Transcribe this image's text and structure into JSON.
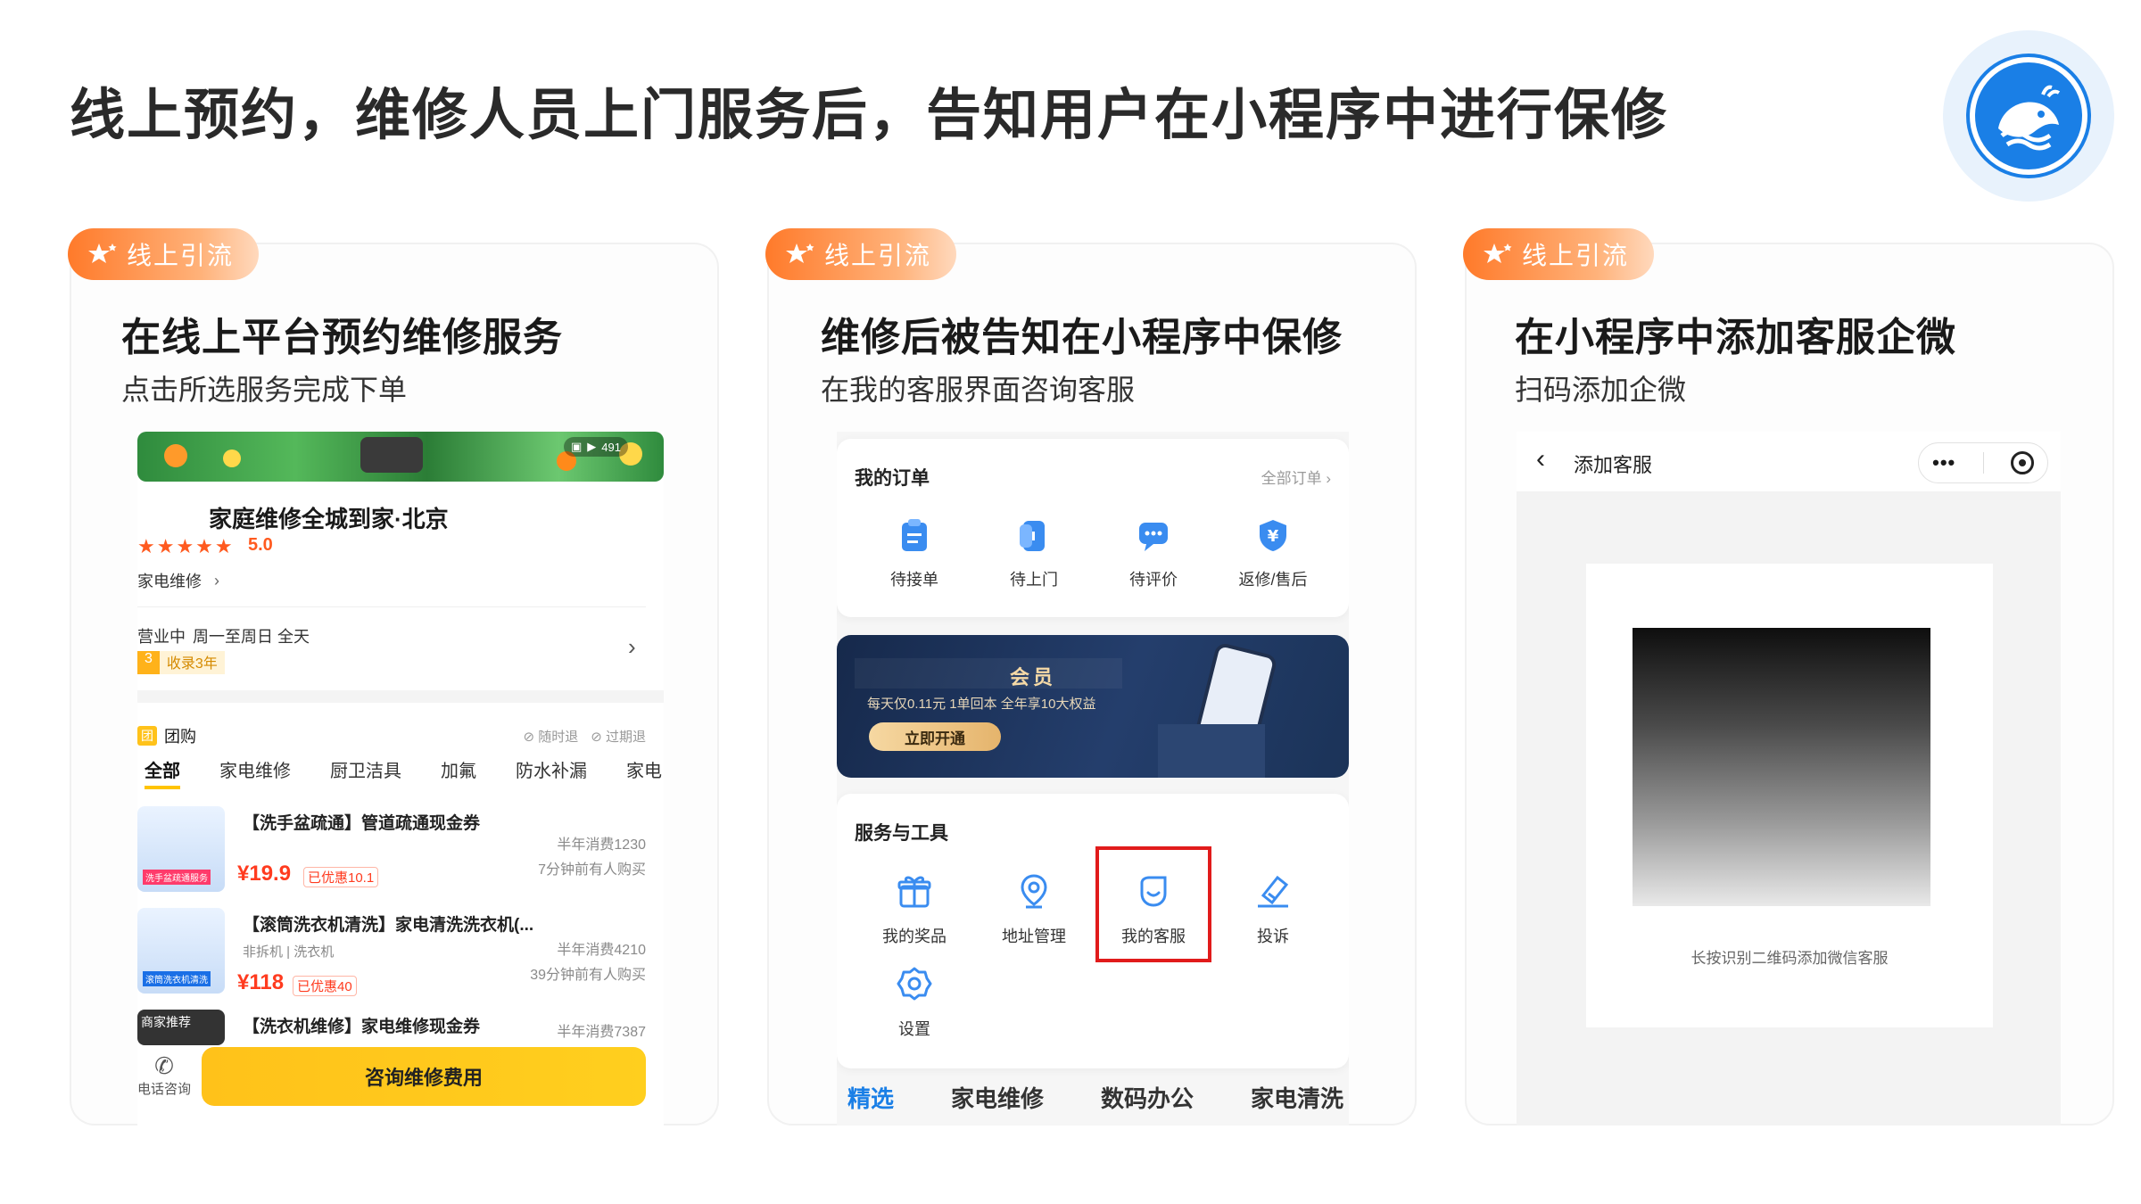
{
  "page": {
    "title": "线上预约，维修人员上门服务后，告知用户在小程序中进行保修"
  },
  "colors": {
    "accent_orange": "#ff7a2a",
    "brand_blue": "#1a7fe6",
    "cta_yellow": "#ffc21a",
    "price_red": "#ff3b1f",
    "highlight_red": "#e11b1b"
  },
  "cards": [
    {
      "tag": "线上引流",
      "title": "在线上平台预约维修服务",
      "subtitle": "点击所选服务完成下单",
      "screen": {
        "banner_count": "491",
        "store_name": "家庭维修全城到家·北京",
        "stars": "★★★★★",
        "rating": "5.0",
        "category": "家电维修",
        "status": "营业中",
        "hours": "周一至周日 全天",
        "badge_num": "3",
        "badge_text": "收录3年",
        "group_label": "团购",
        "group_opts": [
          "随时退",
          "过期退"
        ],
        "tabs": [
          "全部",
          "家电维修",
          "厨卫洁具",
          "加氟",
          "防水补漏",
          "家电"
        ],
        "items": [
          {
            "title": "【洗手盆疏通】管道疏通现金券",
            "price": "¥19.9",
            "discount": "已优惠10.1",
            "sales": "半年消费1230",
            "recent": "7分钟前有人购买",
            "thumb_label": "洗手盆疏通服务"
          },
          {
            "title": "【滚筒洗衣机清洗】家电清洗洗衣机(...",
            "subtitle": "非拆机 | 洗衣机",
            "price": "¥118",
            "discount": "已优惠40",
            "sales": "半年消费4210",
            "recent": "39分钟前有人购买",
            "thumb_label": "滚筒洗衣机清洗"
          },
          {
            "title": "【洗衣机维修】家电维修现金券",
            "sales": "半年消费7387",
            "thumb_label": "商家推荐"
          }
        ],
        "call_label": "电话咨询",
        "cta": "咨询维修费用"
      }
    },
    {
      "tag": "线上引流",
      "title": "维修后被告知在小程序中保修",
      "subtitle": "在我的客服界面咨询客服",
      "screen": {
        "orders_title": "我的订单",
        "orders_link": "全部订单",
        "order_icons": [
          {
            "label": "待接单",
            "icon": "clipboard-icon"
          },
          {
            "label": "待上门",
            "icon": "door-icon"
          },
          {
            "label": "待评价",
            "icon": "chat-icon"
          },
          {
            "label": "返修/售后",
            "icon": "yen-shield-icon"
          }
        ],
        "vip_title": "会员",
        "vip_desc": "每天仅0.11元  1单回本 全年享10大权益",
        "vip_button": "立即开通",
        "tools_title": "服务与工具",
        "tools": [
          {
            "label": "我的奖品",
            "icon": "gift-icon"
          },
          {
            "label": "地址管理",
            "icon": "location-icon"
          },
          {
            "label": "我的客服",
            "icon": "customer-service-icon"
          },
          {
            "label": "投诉",
            "icon": "complaint-icon"
          },
          {
            "label": "设置",
            "icon": "settings-icon"
          }
        ],
        "bottom_tabs": [
          "精选",
          "家电维修",
          "数码办公",
          "家电清洗"
        ]
      }
    },
    {
      "tag": "线上引流",
      "title": "在小程序中添加客服企微",
      "subtitle": "扫码添加企微",
      "screen": {
        "nav_title": "添加客服",
        "caption": "长按识别二维码添加微信客服"
      }
    }
  ]
}
